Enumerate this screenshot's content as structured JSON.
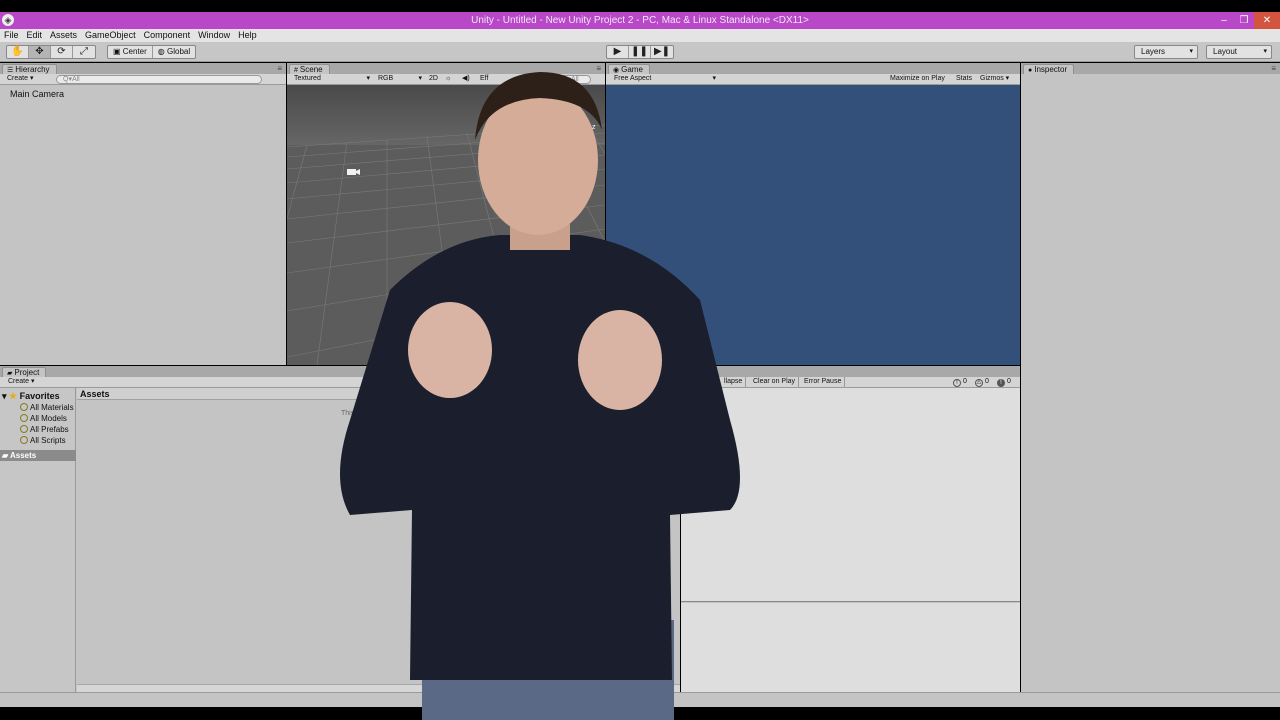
{
  "window": {
    "title": "Unity - Untitled - New Unity Project 2 - PC, Mac & Linux Standalone <DX11>",
    "minimize": "–",
    "restore": "❐",
    "close": "✕"
  },
  "menu": [
    "File",
    "Edit",
    "Assets",
    "GameObject",
    "Component",
    "Window",
    "Help"
  ],
  "toolbar": {
    "tools": [
      "✋",
      "✥",
      "⟳",
      "⤢"
    ],
    "pivot": {
      "center": "Center",
      "global": "Global"
    },
    "play": {
      "play": "▶",
      "pause": "❚❚",
      "step": "▶❚"
    },
    "layers": "Layers",
    "layout": "Layout"
  },
  "hierarchy": {
    "tab": "Hierarchy",
    "create": "Create",
    "search_placeholder": "Q▾All",
    "items": [
      "Main Camera"
    ]
  },
  "scene": {
    "tab": "Scene",
    "shading": "Textured",
    "render": "RGB",
    "mode2d": "2D",
    "effects": "Eff",
    "search_placeholder": "Q▾All",
    "axis_label": "z"
  },
  "game": {
    "tab": "Game",
    "aspect": "Free Aspect",
    "maximize": "Maximize on Play",
    "stats": "Stats",
    "gizmos": "Gizmos"
  },
  "inspector": {
    "tab": "Inspector"
  },
  "project": {
    "tab": "Project",
    "create": "Create",
    "favorites": "Favorites",
    "favorite_items": [
      "All Materials",
      "All Models",
      "All Prefabs",
      "All Scripts"
    ],
    "assets_folder": "Assets",
    "breadcrumb": "Assets",
    "empty_message": "This"
  },
  "console": {
    "collapse": "llapse",
    "clear_on_play": "Clear on Play",
    "error_pause": "Error Pause",
    "info_count": "0",
    "warning_count": "0",
    "error_count": "0"
  },
  "colors": {
    "titlebar": "#b848c8",
    "game_background": "#33507a",
    "scene_background": "#5c5c5c",
    "panel": "#c4c4c4"
  }
}
